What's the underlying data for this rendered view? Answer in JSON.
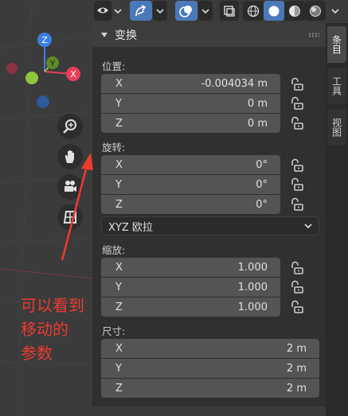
{
  "viewport": {
    "gizmo": {
      "x_label": "X",
      "y_label": "Y",
      "z_label": "Z"
    },
    "nav_buttons": [
      "zoom-icon",
      "hand-pan-icon",
      "camera-icon",
      "grid-view-icon"
    ]
  },
  "toolbar": {
    "icons": [
      "eye-visibility-icon",
      "gizmo-arrow-icon",
      "overlay-icon",
      "xray-icon",
      "wireframe-shading-icon",
      "solid-shading-icon",
      "material-shading-icon",
      "rendered-shading-icon"
    ]
  },
  "panel": {
    "title": "变换",
    "location": {
      "label": "位置:",
      "rows": [
        {
          "axis": "X",
          "value": "-0.004034 m"
        },
        {
          "axis": "Y",
          "value": "0 m"
        },
        {
          "axis": "Z",
          "value": "0 m"
        }
      ]
    },
    "rotation": {
      "label": "旋转:",
      "rows": [
        {
          "axis": "X",
          "value": "0°"
        },
        {
          "axis": "Y",
          "value": "0°"
        },
        {
          "axis": "Z",
          "value": "0°"
        }
      ],
      "mode": "XYZ 欧拉"
    },
    "scale": {
      "label": "缩放:",
      "rows": [
        {
          "axis": "X",
          "value": "1.000"
        },
        {
          "axis": "Y",
          "value": "1.000"
        },
        {
          "axis": "Z",
          "value": "1.000"
        }
      ]
    },
    "dimensions": {
      "label": "尺寸:",
      "rows": [
        {
          "axis": "X",
          "value": "2 m"
        },
        {
          "axis": "Y",
          "value": "2 m"
        },
        {
          "axis": "Z",
          "value": "2 m"
        }
      ]
    }
  },
  "side_tabs": {
    "item": "条目",
    "tool": "工具",
    "view": "视图"
  },
  "annotation": {
    "line1": "可以看到",
    "line2": "移动的",
    "line3": "参数"
  },
  "colors": {
    "accent": "#4b78b8",
    "annotation": "#ee3b30",
    "x_axis": "#e8405a",
    "y_axis": "#8fc63f",
    "z_axis": "#3d7fe0"
  }
}
